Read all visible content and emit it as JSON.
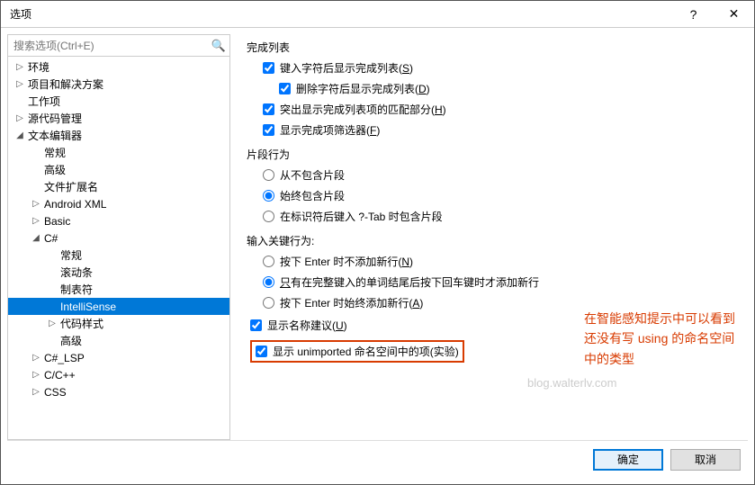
{
  "titlebar": {
    "title": "选项",
    "help": "?",
    "close": "✕"
  },
  "search": {
    "placeholder": "搜索选项(Ctrl+E)"
  },
  "tree": [
    {
      "label": "环境",
      "arrow": "▷",
      "indent": 1
    },
    {
      "label": "项目和解决方案",
      "arrow": "▷",
      "indent": 1
    },
    {
      "label": "工作项",
      "arrow": "",
      "indent": 1
    },
    {
      "label": "源代码管理",
      "arrow": "▷",
      "indent": 1
    },
    {
      "label": "文本编辑器",
      "arrow": "◢",
      "indent": 1
    },
    {
      "label": "常规",
      "arrow": "",
      "indent": 2
    },
    {
      "label": "高级",
      "arrow": "",
      "indent": 2
    },
    {
      "label": "文件扩展名",
      "arrow": "",
      "indent": 2
    },
    {
      "label": "Android XML",
      "arrow": "▷",
      "indent": 2
    },
    {
      "label": "Basic",
      "arrow": "▷",
      "indent": 2
    },
    {
      "label": "C#",
      "arrow": "◢",
      "indent": 2
    },
    {
      "label": "常规",
      "arrow": "",
      "indent": 3
    },
    {
      "label": "滚动条",
      "arrow": "",
      "indent": 3
    },
    {
      "label": "制表符",
      "arrow": "",
      "indent": 3
    },
    {
      "label": "IntelliSense",
      "arrow": "",
      "indent": 3,
      "selected": true
    },
    {
      "label": "代码样式",
      "arrow": "▷",
      "indent": 3
    },
    {
      "label": "高级",
      "arrow": "",
      "indent": 3
    },
    {
      "label": "C#_LSP",
      "arrow": "▷",
      "indent": 2
    },
    {
      "label": "C/C++",
      "arrow": "▷",
      "indent": 2
    },
    {
      "label": "CSS",
      "arrow": "▷",
      "indent": 2
    }
  ],
  "sections": {
    "completion": {
      "title": "完成列表",
      "show_after_char": "键入字符后显示完成列表(S)",
      "show_after_delete": "删除字符后显示完成列表(D)",
      "highlight_match": "突出显示完成列表项的匹配部分(H)",
      "show_filters": "显示完成项筛选器(F)"
    },
    "snippet": {
      "title": "片段行为",
      "never": "从不包含片段",
      "always": "始终包含片段",
      "tab": "在标识符后键入 ?-Tab 时包含片段"
    },
    "enter": {
      "title": "输入关键行为:",
      "no_newline": "按下 Enter 时不添加新行(N)",
      "only_full": "只有在完整键入的单词结尾后按下回车键时才添加新行",
      "always_newline": "按下 Enter 时始终添加新行(A)"
    },
    "names": {
      "show_suggestions": "显示名称建议(U)",
      "show_unimported": "显示 unimported 命名空间中的项(实验)"
    }
  },
  "annotation": {
    "line1": "在智能感知提示中可以看到",
    "line2": "还没有写 using 的命名空间",
    "line3": "中的类型"
  },
  "watermark": "blog.walterlv.com",
  "footer": {
    "ok": "确定",
    "cancel": "取消"
  }
}
